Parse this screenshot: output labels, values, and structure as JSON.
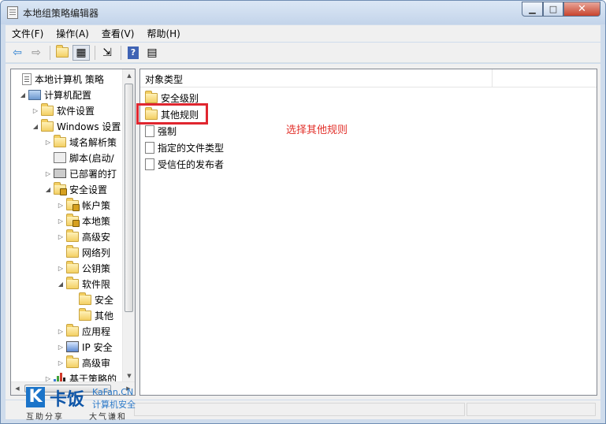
{
  "window": {
    "title": "本地组策略编辑器",
    "minimize_icon": "minimize-icon",
    "maximize_icon": "maximize-icon",
    "close_icon": "close-icon"
  },
  "menu": {
    "items": [
      "文件(F)",
      "操作(A)",
      "查看(V)",
      "帮助(H)"
    ]
  },
  "toolbar": {
    "icons": [
      "back-arrow-icon",
      "forward-arrow-icon",
      "up-folder-icon",
      "show-hide-tree-icon",
      "export-list-icon",
      "help-icon",
      "properties-icon"
    ]
  },
  "tree": {
    "nodes": [
      {
        "label": "本地计算机 策略",
        "icon": "policy-icon",
        "expander": ""
      },
      {
        "label": "计算机配置",
        "icon": "computer-icon",
        "expander": "◢"
      },
      {
        "label": "软件设置",
        "icon": "folder-icon",
        "expander": "▷"
      },
      {
        "label": "Windows 设置",
        "icon": "folder-icon",
        "expander": "◢"
      },
      {
        "label": "域名解析策",
        "icon": "folder-icon",
        "expander": "▷"
      },
      {
        "label": "脚本(启动/",
        "icon": "script-icon",
        "expander": ""
      },
      {
        "label": "已部署的打",
        "icon": "printer-icon",
        "expander": "▷"
      },
      {
        "label": "安全设置",
        "icon": "secure-folder-icon",
        "expander": "◢"
      },
      {
        "label": "帐户策",
        "icon": "secure-folder-icon",
        "expander": "▷"
      },
      {
        "label": "本地策",
        "icon": "secure-folder-icon",
        "expander": "▷"
      },
      {
        "label": "高级安",
        "icon": "folder-icon",
        "expander": "▷"
      },
      {
        "label": "网络列",
        "icon": "folder-icon",
        "expander": ""
      },
      {
        "label": "公钥策",
        "icon": "folder-icon",
        "expander": "▷"
      },
      {
        "label": "软件限",
        "icon": "folder-icon",
        "expander": "◢"
      },
      {
        "label": "安全",
        "icon": "folder-icon",
        "expander": ""
      },
      {
        "label": "其他",
        "icon": "folder-icon",
        "expander": ""
      },
      {
        "label": "应用程",
        "icon": "folder-icon",
        "expander": "▷"
      },
      {
        "label": "IP 安全",
        "icon": "ip-security-icon",
        "expander": "▷"
      },
      {
        "label": "高级审",
        "icon": "folder-icon",
        "expander": "▷"
      },
      {
        "label": "基于策略的",
        "icon": "chart-icon",
        "expander": "▷"
      }
    ]
  },
  "list": {
    "column_header": "对象类型",
    "items": [
      {
        "label": "安全级别",
        "icon": "folder-icon"
      },
      {
        "label": "其他规则",
        "icon": "folder-icon"
      },
      {
        "label": "强制",
        "icon": "binary-file-icon"
      },
      {
        "label": "指定的文件类型",
        "icon": "binary-file-icon"
      },
      {
        "label": "受信任的发布者",
        "icon": "binary-file-icon"
      }
    ]
  },
  "annotation": {
    "text": "选择其他规则",
    "color": "#e2302a"
  },
  "watermark": {
    "logo_letter": "K",
    "brand": "卡饭",
    "en": "KaFan.CN",
    "slogan_left": "互助分享",
    "cn": "计算机安全",
    "slogan_right": "大气谦和"
  },
  "colors": {
    "accent": "#1b74c9",
    "highlight_border": "#e0262f"
  }
}
